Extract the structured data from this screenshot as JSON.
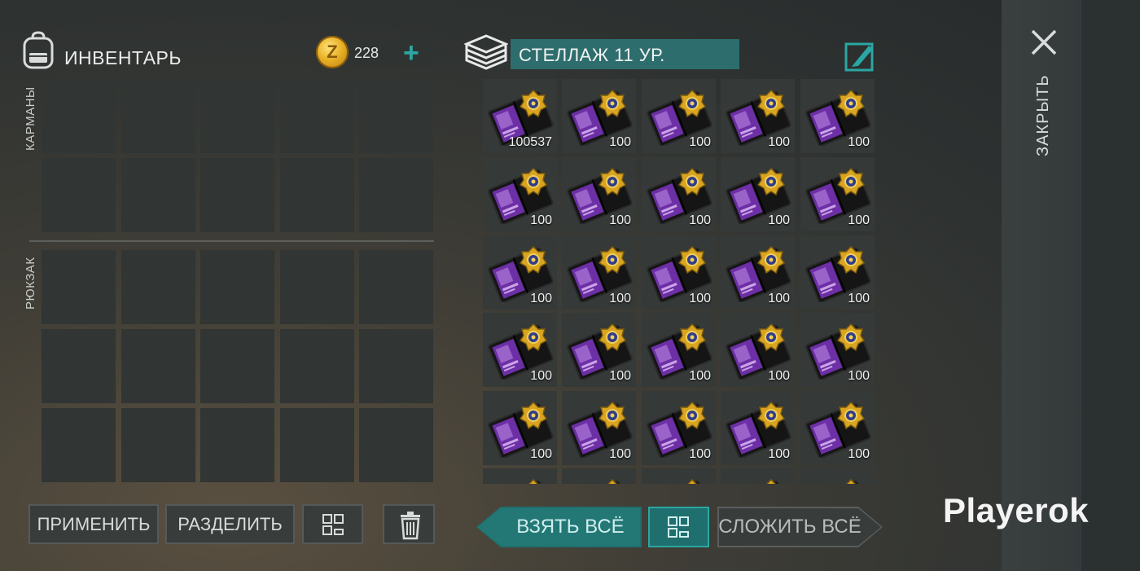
{
  "header": {
    "inventory_title": "ИНВЕНТАРЬ",
    "coin_count": "228",
    "coin_letter": "Z",
    "add_label": "+"
  },
  "inventory": {
    "pockets_label": "КАРМАНЫ",
    "backpack_label": "РЮКЗАК",
    "pocket_rows": 2,
    "backpack_rows": 3,
    "columns": 5
  },
  "container": {
    "title": "СТЕЛЛАЖ 11 УР.",
    "item_name": "police-badge-wallet",
    "counts": [
      "100537",
      "100",
      "100",
      "100",
      "100",
      "100",
      "100",
      "100",
      "100",
      "100",
      "100",
      "100",
      "100",
      "100",
      "100",
      "100",
      "100",
      "100",
      "100",
      "100",
      "100",
      "100",
      "100",
      "100",
      "100"
    ]
  },
  "buttons": {
    "apply": "ПРИМЕНИТЬ",
    "split": "РАЗДЕЛИТЬ",
    "take_all": "ВЗЯТЬ ВСЁ",
    "put_all": "СЛОЖИТЬ ВСЁ"
  },
  "close": {
    "label": "ЗАКРЫТЬ"
  },
  "watermark": "Playerok",
  "colors": {
    "accent": "#2aa7a3",
    "title_bg": "#2e6d6d",
    "coin": "#e8b025"
  }
}
